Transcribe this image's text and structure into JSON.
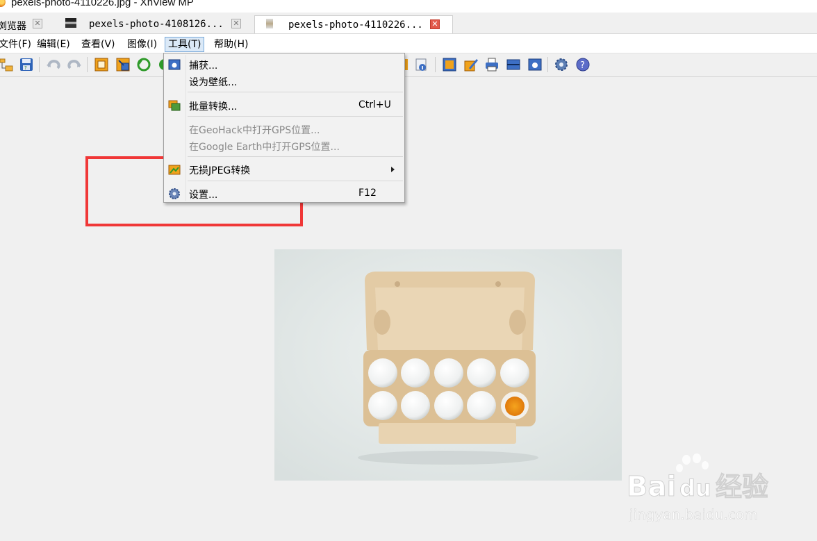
{
  "window": {
    "title": "pexels-photo-4110226.jpg - XnView MP"
  },
  "tabs": [
    {
      "label": "浏览器",
      "close": "✕"
    },
    {
      "label": "pexels-photo-4108126...",
      "close": "✕"
    },
    {
      "label": "pexels-photo-4110226...",
      "close": "✕"
    }
  ],
  "menubar": {
    "items": [
      {
        "label": "文件(F)"
      },
      {
        "label": "编辑(E)"
      },
      {
        "label": "查看(V)"
      },
      {
        "label": "图像(I)"
      },
      {
        "label": "工具(T)"
      },
      {
        "label": "帮助(H)"
      }
    ]
  },
  "toolbar": {
    "buttons": [
      "folder-tree-icon",
      "save-icon",
      "undo-icon",
      "redo-icon",
      "crop-icon",
      "resize-icon",
      "rotate-icon",
      "fit-screen-icon",
      "edit-icon",
      "print-icon",
      "scanner-icon",
      "capture-icon",
      "settings-icon",
      "help-icon"
    ]
  },
  "tools_menu": {
    "items": [
      {
        "label": "捕获...",
        "icon": "capture-icon",
        "shortcut": ""
      },
      {
        "label": "设为壁纸...",
        "icon": "",
        "shortcut": ""
      },
      {
        "label": "批量转换...",
        "icon": "batch-convert-icon",
        "shortcut": "Ctrl+U"
      },
      {
        "label": "在GeoHack中打开GPS位置...",
        "icon": "",
        "shortcut": "",
        "disabled": true
      },
      {
        "label": "在Google Earth中打开GPS位置...",
        "icon": "",
        "shortcut": "",
        "disabled": true
      },
      {
        "label": "无损JPEG转换",
        "icon": "jpeg-transform-icon",
        "shortcut": "",
        "submenu": true
      },
      {
        "label": "设置...",
        "icon": "gear-icon",
        "shortcut": "F12"
      }
    ]
  },
  "watermark": {
    "brand": "Bai",
    "brand2": "du",
    "product": "经验",
    "url": "jingyan.baidu.com"
  },
  "colors": {
    "highlight_box": "#f03737",
    "menu_open_bg": "#dbe9f7",
    "tab_close_active": "#e2594a"
  }
}
